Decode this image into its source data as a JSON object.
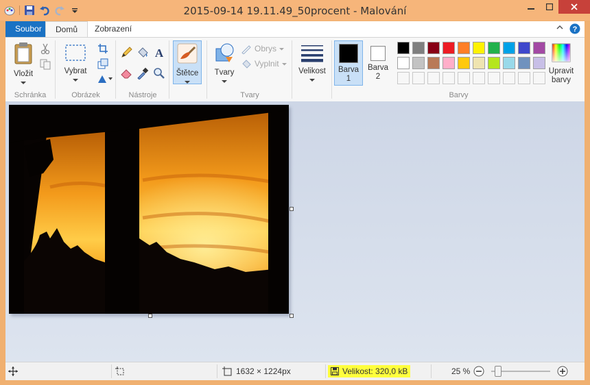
{
  "window": {
    "title": "2015-09-14 19.11.49_50procent - Malování",
    "buttons": {
      "minimize": "–",
      "maximize": "□",
      "close": "✕"
    }
  },
  "quick_access": [
    "paint-logo-icon",
    "save-icon",
    "undo-icon",
    "redo-icon",
    "customize-qat-icon"
  ],
  "tabs": {
    "file": "Soubor",
    "home": "Domů",
    "view": "Zobrazení",
    "help": "?",
    "collapse": "⌃"
  },
  "ribbon": {
    "clipboard": {
      "paste": "Vložit",
      "label": "Schránka"
    },
    "image": {
      "select": "Vybrat",
      "label": "Obrázek"
    },
    "tools": {
      "label": "Nástroje"
    },
    "brushes": {
      "label": "Štětce"
    },
    "shapes": {
      "shapes": "Tvary",
      "outline": "Obrys",
      "fill": "Vyplnit",
      "label": "Tvary"
    },
    "size": {
      "label": "Velikost"
    },
    "colors": {
      "color1_label": "Barva",
      "color1_num": "1",
      "color2_label": "Barva",
      "color2_num": "2",
      "edit_colors_1": "Upravit",
      "edit_colors_2": "barvy",
      "label": "Barvy",
      "color1": "#000000",
      "color2": "#ffffff",
      "palette_row1": [
        "#000000",
        "#7f7f7f",
        "#880015",
        "#ed1c24",
        "#ff7f27",
        "#fff200",
        "#22b14c",
        "#00a2e8",
        "#3f48cc",
        "#a349a4"
      ],
      "palette_row2": [
        "#ffffff",
        "#c3c3c3",
        "#b97a57",
        "#ffaec9",
        "#ffc90e",
        "#efe4b0",
        "#b5e61d",
        "#99d9ea",
        "#7092be",
        "#c8bfe7"
      ]
    }
  },
  "statusbar": {
    "dimensions": "1632 × 1224px",
    "file_size": "Velikost: 320,0 kB",
    "zoom": "25 %",
    "zoom_fraction": 0.1
  }
}
